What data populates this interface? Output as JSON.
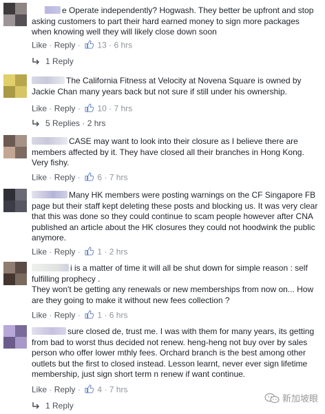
{
  "comments": [
    {
      "text": "e Operate independently? Hogwash. They better be upfront and stop asking customers to part their hard earned money to sign more packages when knowing well they will likely close down soon",
      "like_label": "Like",
      "reply_label": "Reply",
      "likes": "13",
      "time": "6 hrs",
      "replies_label": "1 Reply"
    },
    {
      "text": "The California Fitness at Velocity at Novena Square is owned by Jackie Chan many years back but not sure if still under his ownership.",
      "like_label": "Like",
      "reply_label": "Reply",
      "likes": "10",
      "time": "7 hrs",
      "replies_label": "5 Replies · 2 hrs"
    },
    {
      "text": "CASE may want to look into their closure as I believe there are members affected by it. They have closed all their branches in Hong Kong. Very fishy.",
      "like_label": "Like",
      "reply_label": "Reply",
      "likes": "6",
      "time": "7 hrs"
    },
    {
      "text": "Many HK members were posting warnings on the CF Singapore FB page but their staff kept deleting these posts and blocking us. It was very clear that this was done so they could continue to scam people however after CNA published an article about the HK closures they could not hoodwink the public anymore.",
      "like_label": "Like",
      "reply_label": "Reply",
      "likes": "1",
      "time": "2 hrs"
    },
    {
      "text": "i is a matter of time it will all be shut down for simple reason : self fulfilling prophecy .\nThey won't be getting any renewals or new memberships from now on... How are they going to make it without new fees collection ?",
      "like_label": "Like",
      "reply_label": "Reply",
      "likes": "1",
      "time": "6 hrs"
    },
    {
      "text": "sure closed de, trust me. I was with them for many years, its getting from bad to worst thus decided not renew. heng-heng not buy over by sales person who offer lower mthly fees. Orchard branch is the best among other outlets but the first to closed instead. Lesson learnt, never ever sign lifetime membership, just sign short term n renew if want continue.",
      "like_label": "Like",
      "reply_label": "Reply",
      "likes": "4",
      "time": "7 hrs",
      "replies_label": "1 Reply"
    }
  ],
  "watermark": "新加坡眼",
  "colors": {
    "text": "#1d2129",
    "meta": "#90949c",
    "link": "#4b4f56",
    "like_blue": "#5b7bc0"
  }
}
